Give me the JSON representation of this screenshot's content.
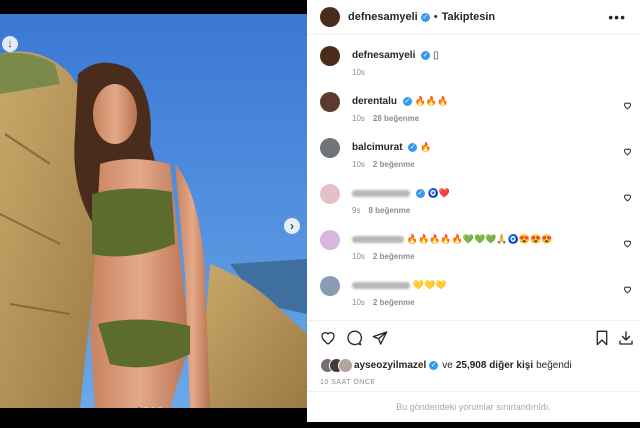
{
  "post": {
    "author": "defnesamyeli",
    "follow_status": "Takiptesin",
    "more_menu": "•••",
    "caption_emoji": "▯",
    "caption_time": "10s"
  },
  "comments": [
    {
      "username": "derentalu",
      "text": "🔥🔥🔥",
      "time": "10s",
      "likes": "28 beğenme",
      "avatar_color": "#5a3b2e"
    },
    {
      "username": "balcimurat",
      "text": "🔥",
      "time": "10s",
      "likes": "2 beğenme",
      "avatar_color": "#6f7478"
    },
    {
      "username": "",
      "text": "🧿❤️",
      "time": "9s",
      "likes": "8 beğenme",
      "avatar_color": "#e6c0c7"
    },
    {
      "username": "",
      "text": "🔥🔥🔥🔥🔥💚💚💚🙏🧿😍😍😍",
      "time": "10s",
      "likes": "2 beğenme",
      "avatar_color": "#d7b6e0"
    },
    {
      "username": "",
      "text": "💛💛💛",
      "time": "10s",
      "likes": "2 beğenme",
      "avatar_color": "#8a9bb5"
    }
  ],
  "likes_bar": {
    "liker": "ayseozyilmazel",
    "connector": "ve",
    "others": "25,908 diğer kişi",
    "suffix": "beğendi",
    "time_ago": "10 SAAT ÖNCE"
  },
  "comments_closed": "Bu gönderideki yorumlar sınırlandırıldı.",
  "icons": [
    "download-icon",
    "next-arrow-icon",
    "more-icon",
    "heart-icon",
    "comment-icon",
    "share-icon",
    "save-icon",
    "download-icon"
  ],
  "colors": {
    "verified": "#3897f0",
    "carousel_active": "#3d8bf2"
  }
}
